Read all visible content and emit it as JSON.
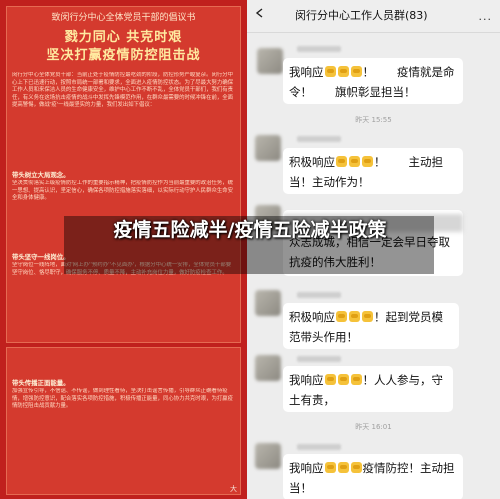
{
  "poster": {
    "title": "致闵行分中心全体党员干部的倡议书",
    "slogan_line1": "戮力同心 共克时艰",
    "slogan_line2": "坚决打赢疫情防控阻击战",
    "heading1": "带头树立大局观念。",
    "heading2": "带头坚守一线岗位。",
    "heading3": "带头传播正面能量。",
    "signature": "大",
    "para_intro": "闵行分中心全体党员干部：当前正处于疫情防控最吃劲的阶段，防控形势严峻复杂。闵行分中心上下已迅速行动，按照市局统一部署和要求，全面进入疫情防控状态。为了尽最大努力确保工作人员和来保洁人员的生命健康安全，维护中心工作不断不乱，全体党员干部们，我们有责任，有义务在这场抗击疫情的战斗中发挥先锋模范作用，在群众最需要的时候冲锋在前，全面提高警惕，做战'疫'一线最坚实的力量，我们发出如下倡议：",
    "para_1": "坚决贯彻落实上级疫情防控工作的重要指示精神，把疫情防控作为当前最重要的政治任务，统一思想、提高认识，坚定信心，确保各项防控措施落实落细，以实际行动守护人民群众生命安全和身体健康。",
    "para_2": "坚守岗位一线阵地，面对'网上办''预约办''不见面办'，根据分中心统一安排，全体党员干部要坚守岗位、恪尽职守，确保服务不停、质量不降，主动补充岗位力量，做好防疫检查工作。",
    "para_3": "加强宣传引导，不信谣、不传谣，做到理性看待，坚决打击谣言传播，引导群众正确看待疫情，增强防控意识，配合落实各项防控措施，积极传播正能量，同心协力共克时艰，为打赢疫情防控阻击战贡献力量。"
  },
  "chat": {
    "title": "闵行分中心工作人员群(83)",
    "more_label": "...",
    "messages": [
      {
        "text_before": "我响应",
        "emoji_count": 3,
        "text_after": "！　　疫情就是命令！　　旗帜彰显担当！"
      },
      {
        "text_before": "积极响应",
        "emoji_count": 3,
        "text_after": "！　　主动担当！主动作为！"
      },
      {
        "text_before": "",
        "emoji_count": 0,
        "text_after": "众志成城，相信一定会早日夺取抗疫的伟大胜利！"
      },
      {
        "text_before": "积极响应",
        "emoji_count": 3,
        "text_after": "！起到党员模范带头作用！"
      },
      {
        "text_before": "我响应",
        "emoji_count": 3,
        "text_after": "！人人参与，守土有责，"
      },
      {
        "text_before": "我响应",
        "emoji_count": 3,
        "text_after": "疫情防控！主动担当！"
      }
    ],
    "timestamps": [
      "昨天 15:55",
      "昨天 16:01"
    ]
  },
  "overlay": {
    "caption": "疫情五险减半/疫情五险减半政策"
  },
  "colors": {
    "poster_red": "#c0201d",
    "chat_bg": "#ededed",
    "bubble": "#ffffff",
    "emoji": "#f5c23a"
  }
}
